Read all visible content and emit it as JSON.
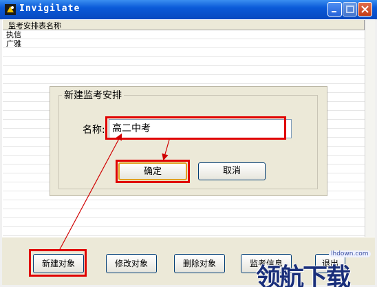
{
  "window": {
    "title": "Invigilate",
    "controls": {
      "minimize": "minimize-icon",
      "maximize": "maximize-icon",
      "close": "close-icon"
    }
  },
  "list": {
    "column_header": "监考安排表名称",
    "items": [
      "执信",
      "广雅"
    ]
  },
  "dialog": {
    "title": "新建监考安排",
    "name_label": "名称:",
    "name_value": "高二中考",
    "ok_label": "确定",
    "cancel_label": "取消"
  },
  "toolbar": {
    "new_label": "新建对象",
    "edit_label": "修改对象",
    "delete_label": "删除对象",
    "info_label": "监考信息",
    "exit_label": "退出"
  },
  "watermark": {
    "url": "lhdown.com",
    "text": "领航下载"
  },
  "colors": {
    "titlebar": "#0a5ad8",
    "highlight": "#e00000",
    "panel": "#ece9d8"
  }
}
